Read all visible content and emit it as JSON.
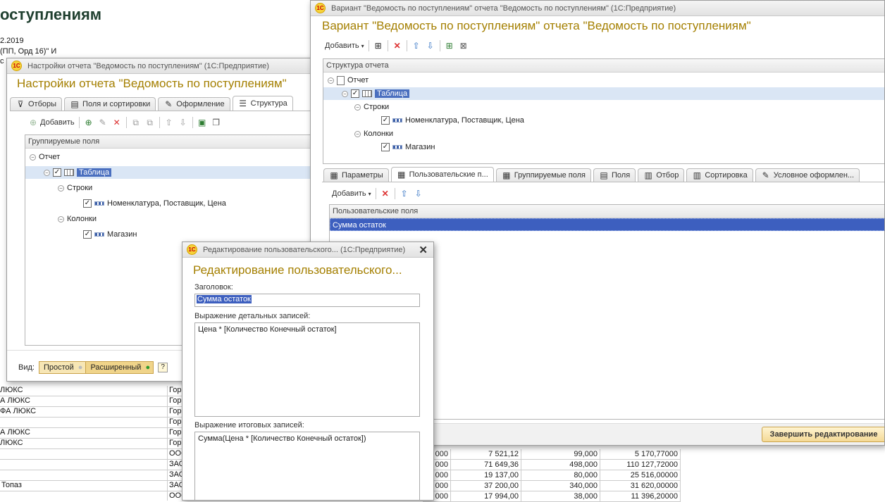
{
  "background": {
    "heading": "оступлениям",
    "line1": "2.2019",
    "line2": "(ПП, Орд 16)\" И",
    "line3": "с",
    "left_rows": [
      "ЛЮКС",
      "А ЛЮКС",
      "ФА ЛЮКС",
      "",
      "А ЛЮКС",
      "ЛЮКС",
      "",
      "",
      "Топаз",
      ""
    ],
    "col2_rows": [
      "Гор",
      "Гор",
      "Гор",
      "Гор",
      "Гор",
      "Гор",
      "ООС",
      "ЗАО",
      "ЗАО",
      "ЗАО",
      "ООС"
    ],
    "bottom_rows": [
      {
        "a": "000",
        "b": "7 521,12",
        "c": "99,000",
        "d": "5 170,77000"
      },
      {
        "a": "000",
        "b": "71 649,36",
        "c": "498,000",
        "d": "110 127,72000"
      },
      {
        "a": "000",
        "b": "19 137,00",
        "c": "80,000",
        "d": "25 516,00000"
      },
      {
        "a": "000",
        "b": "37 200,00",
        "c": "340,000",
        "d": "31 620,00000"
      },
      {
        "a": "000",
        "b": "17 994,00",
        "c": "38,000",
        "d": "11 396,20000"
      }
    ]
  },
  "settings_window": {
    "titlebar": "Настройки отчета \"Ведомость по поступлениям\"  (1С:Предприятие)",
    "title": "Настройки отчета \"Ведомость по поступлениям\"",
    "tabs": [
      "Отборы",
      "Поля и сортировки",
      "Оформление",
      "Структура"
    ],
    "add_label": "Добавить",
    "panel_header": "Группируемые поля",
    "tree": {
      "root": "Отчет",
      "table": "Таблица",
      "rows": "Строки",
      "rows_fields": "Номенклатура, Поставщик, Цена",
      "columns": "Колонки",
      "columns_fields": "Магазин"
    },
    "view_label": "Вид:",
    "view_simple": "Простой",
    "view_extended": "Расширенный",
    "help": "?"
  },
  "variant_window": {
    "titlebar": "Вариант \"Ведомость по поступлениям\" отчета \"Ведомость по поступлениям\"  (1С:Предприятие)",
    "title": "Вариант \"Ведомость по поступлениям\" отчета \"Ведомость по поступлениям\"",
    "add_label": "Добавить",
    "structure_header": "Структура отчета",
    "tree": {
      "root": "Отчет",
      "table": "Таблица",
      "rows": "Строки",
      "rows_fields": "Номенклатура, Поставщик, Цена",
      "columns": "Колонки",
      "columns_fields": "Магазин"
    },
    "tabs": [
      "Параметры",
      "Пользовательские п...",
      "Группируемые поля",
      "Поля",
      "Отбор",
      "Сортировка",
      "Условное оформлен..."
    ],
    "fields_add_label": "Добавить",
    "fields_header": "Пользовательские поля",
    "fields": [
      "Сумма остаток"
    ],
    "finish_button": "Завершить редактирование"
  },
  "edit_dialog": {
    "titlebar": "Редактирование пользовательского...  (1С:Предприятие)",
    "title": "Редактирование пользовательского...",
    "caption_label": "Заголовок:",
    "caption_value": "Сумма остаток",
    "detail_label": "Выражение детальных записей:",
    "detail_value": "Цена * [Количество Конечный остаток]",
    "total_label": "Выражение итоговых записей:",
    "total_value": "Сумма(Цена * [Количество Конечный остаток])"
  }
}
